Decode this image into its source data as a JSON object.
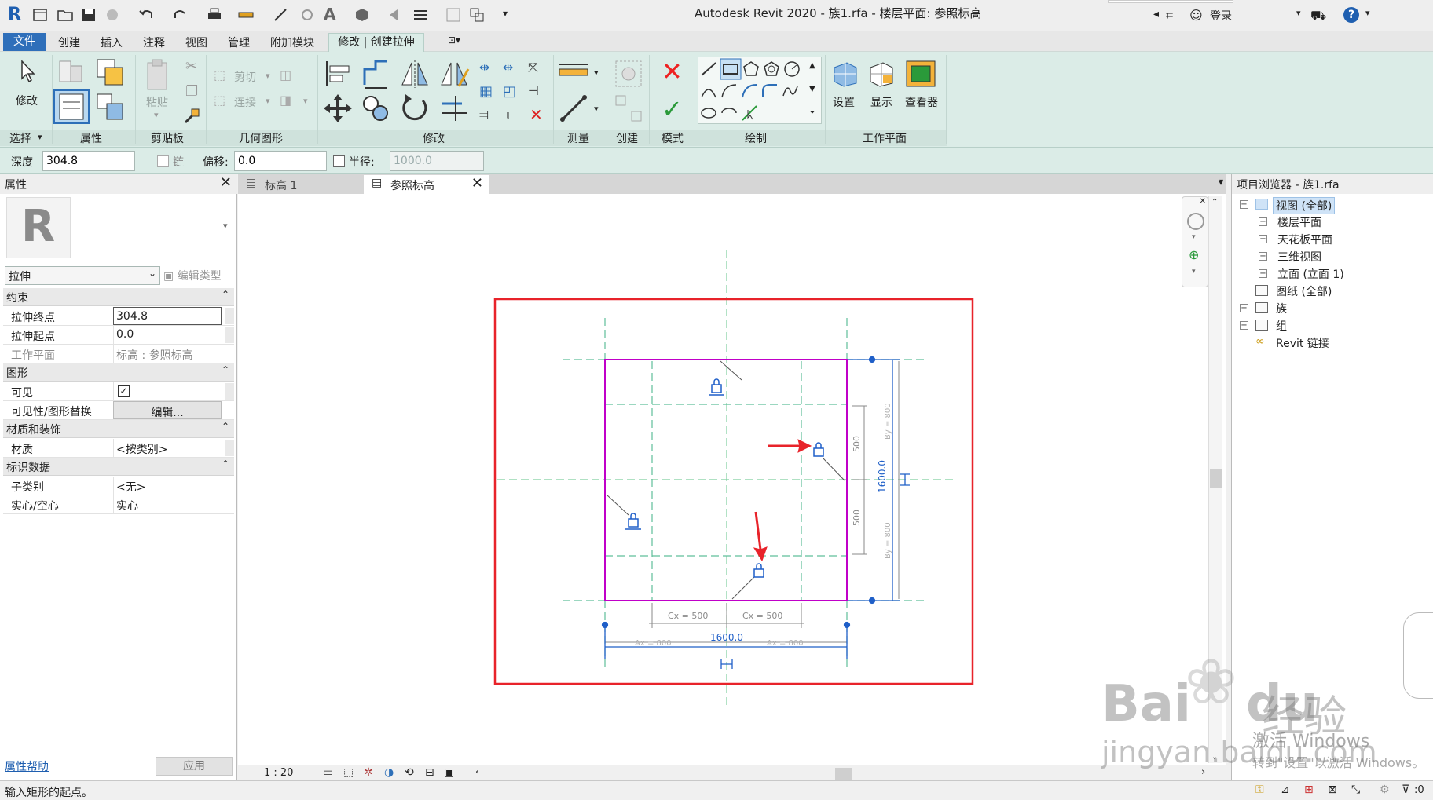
{
  "window": {
    "title": "Autodesk Revit 2020 - 族1.rfa - 楼层平面: 参照标高",
    "login": "登录",
    "app_logo": "R"
  },
  "tabs": {
    "file": "文件",
    "items": [
      "创建",
      "插入",
      "注释",
      "视图",
      "管理",
      "附加模块"
    ],
    "active": "修改 | 创建拉伸"
  },
  "ribbon": {
    "modify_label": "修改",
    "paste_label": "粘贴",
    "cut_label": "剪切",
    "join_label": "连接",
    "panels": [
      "选择",
      "属性",
      "剪贴板",
      "几何图形",
      "修改",
      "测量",
      "创建",
      "模式",
      "绘制",
      "工作平面"
    ],
    "workplane_buttons": [
      "设置",
      "显示",
      "查看器"
    ]
  },
  "options_bar": {
    "depth_label": "深度",
    "depth_value": "304.8",
    "chain_label": "链",
    "offset_label": "偏移:",
    "offset_value": "0.0",
    "radius_label": "半径:",
    "radius_value": "1000.0"
  },
  "properties": {
    "title": "属性",
    "type_name": "拉伸",
    "edit_type": "编辑类型",
    "sections": [
      {
        "name": "约束",
        "rows": [
          {
            "key": "拉伸终点",
            "value": "304.8"
          },
          {
            "key": "拉伸起点",
            "value": "0.0"
          },
          {
            "key": "工作平面",
            "value": "标高 : 参照标高"
          }
        ]
      },
      {
        "name": "图形",
        "rows": [
          {
            "key": "可见",
            "value": ""
          },
          {
            "key": "可见性/图形替换",
            "value": "编辑..."
          }
        ]
      },
      {
        "name": "材质和装饰",
        "rows": [
          {
            "key": "材质",
            "value": "<按类别>"
          }
        ]
      },
      {
        "name": "标识数据",
        "rows": [
          {
            "key": "子类别",
            "value": "<无>"
          },
          {
            "key": "实心/空心",
            "value": "实心"
          }
        ]
      }
    ],
    "help_link": "属性帮助",
    "apply": "应用"
  },
  "doc_tabs": [
    "标高 1",
    "参照标高"
  ],
  "drawing": {
    "cx_left": "Cx = 500",
    "cx_right": "Cx = 500",
    "width_total": "1600.0",
    "ax_left": "Ax = 800",
    "ax_right": "Ax = 800",
    "height_total": "1600.0",
    "by_top": "By = 800",
    "by_bottom": "By = 800",
    "dim_500_top": "500",
    "dim_500_bottom": "500"
  },
  "view_bar": {
    "scale": "1 : 20"
  },
  "browser": {
    "title": "项目浏览器 - 族1.rfa",
    "items": [
      {
        "label": "视图 (全部)"
      },
      {
        "label": "楼层平面"
      },
      {
        "label": "天花板平面"
      },
      {
        "label": "三维视图"
      },
      {
        "label": "立面 (立面 1)"
      },
      {
        "label": "图纸 (全部)"
      },
      {
        "label": "族"
      },
      {
        "label": "组"
      },
      {
        "label": "Revit 链接"
      }
    ]
  },
  "status": {
    "text": "输入矩形的起点。",
    "filter_count": ":0"
  },
  "watermark": {
    "brand": "Bai",
    "brand2": "du",
    "brand_cn": "经验",
    "site": "jingyan.baidu.com",
    "activate": "激活 Windows",
    "activate_sub": "转到\"设置\"以激活 Windows。"
  },
  "colors": {
    "ribbon_bg": "#dbece7",
    "sketch_magenta": "#c000c8",
    "dimension_blue": "#1f5fc8",
    "highlight_red": "#e8232a",
    "ref_plane_green": "#5fbf9a"
  }
}
